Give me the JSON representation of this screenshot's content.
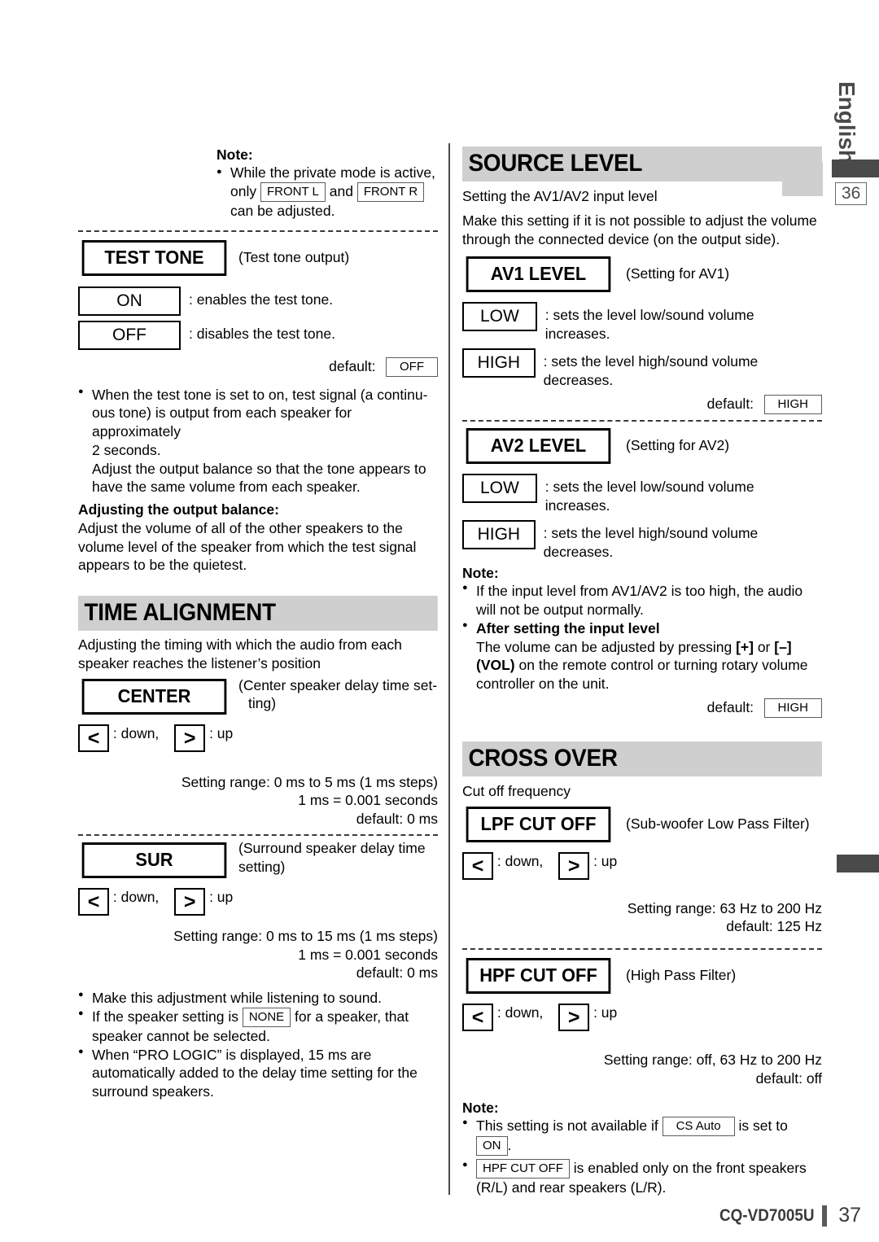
{
  "page": {
    "language_tab": "English",
    "ref_page_number": "36",
    "footer_model": "CQ-VD7005U",
    "footer_page": "37"
  },
  "left_column": {
    "note_top": {
      "label": "Note:",
      "bullets": [
        {
          "parts": [
            {
              "type": "text",
              "value": "While the private mode is active, only "
            },
            {
              "type": "ref",
              "value": "FRONT L"
            },
            {
              "type": "text",
              "value": " and "
            },
            {
              "type": "ref",
              "value": "FRONT R"
            },
            {
              "type": "text",
              "value": " can be adjusted."
            }
          ]
        }
      ]
    },
    "test_tone": {
      "key_label": "TEST TONE",
      "caption": "(Test tone output)",
      "options": [
        {
          "box": "ON",
          "desc": ": enables the test tone."
        },
        {
          "box": "OFF",
          "desc": ": disables the test tone."
        }
      ],
      "default_label": "default:",
      "default_value": "OFF",
      "bullets": [
        "When the test tone is set to on,  test signal (a continu-ous tone) is output from each speaker for approximately 2 seconds.",
        "Adjust the output balance so that the tone appears to have the same volume from each speaker."
      ],
      "bullet_line_1a": "When the test tone is set to on,  test signal (a continu-",
      "bullet_line_1b": "ous tone) is output from each speaker for approximately",
      "bullet_line_1c": "2 seconds.",
      "bullet_line_1d": "Adjust the output balance so that the tone appears to",
      "bullet_line_1e": "have the same volume from each speaker.",
      "balance_heading": "Adjusting the output balance:",
      "balance_body": "Adjust the volume of all of the other speakers to the volume level of the speaker from which the test signal appears to be the quietest."
    },
    "time_alignment": {
      "heading": "TIME ALIGNMENT",
      "intro": "Adjusting the timing with which the audio from each speaker reaches the listener’s position",
      "center": {
        "key_label": "CENTER",
        "caption_line1": "(Center speaker delay time set-",
        "caption_line2": "ting)",
        "down_label": ": down,",
        "up_label": ": up",
        "down_glyph": "<",
        "up_glyph": ">",
        "range": "Setting range: 0 ms to 5 ms (1 ms steps)",
        "conversion": "1 ms = 0.001 seconds",
        "default": "default: 0 ms"
      },
      "sur": {
        "key_label": "SUR",
        "caption_line1": "(Surround speaker delay time",
        "caption_line2": "setting)",
        "down_label": ": down,",
        "up_label": ": up",
        "down_glyph": "<",
        "up_glyph": ">",
        "range": "Setting range: 0 ms to 15 ms (1 ms steps)",
        "conversion": "1 ms = 0.001 seconds",
        "default": "default: 0 ms"
      },
      "notes": [
        {
          "parts": [
            {
              "type": "text",
              "value": "Make this adjustment while listening to sound."
            }
          ]
        },
        {
          "parts": [
            {
              "type": "text",
              "value": "If the speaker setting is "
            },
            {
              "type": "ref",
              "value": "NONE"
            },
            {
              "type": "text",
              "value": " for a speaker, that speaker cannot be selected."
            }
          ]
        },
        {
          "parts": [
            {
              "type": "text",
              "value": "When “PRO LOGIC” is displayed, 15 ms are automatically added to the delay time setting for the surround speakers."
            }
          ]
        }
      ]
    }
  },
  "right_column": {
    "source_level": {
      "heading": "SOURCE LEVEL",
      "subtitle": "Setting the AV1/AV2 input level",
      "intro": "Make this setting if it is not possible to adjust the volume through the connected device (on the output side).",
      "av1": {
        "key_label": "AV1 LEVEL",
        "caption": "(Setting for AV1)",
        "options": [
          {
            "box": "LOW",
            "desc": ": sets the level low/sound volume increases."
          },
          {
            "box": "HIGH",
            "desc": ": sets the level high/sound volume decreases."
          }
        ],
        "default_label": "default:",
        "default_value": "HIGH"
      },
      "av2": {
        "key_label": "AV2 LEVEL",
        "caption": "(Setting for AV2)",
        "options": [
          {
            "box": "LOW",
            "desc": ": sets the level low/sound volume increases."
          },
          {
            "box": "HIGH",
            "desc": ": sets the level high/sound volume decreases."
          }
        ],
        "default_label": "default:",
        "default_value": "HIGH"
      },
      "note_label": "Note:",
      "note_bullet_1": "If the input level from AV1/AV2 is too high, the audio will not be output normally.",
      "note_bullet_2_heading": "After setting the input level",
      "note_bullet_2_pre": "The volume can be adjusted by pressing ",
      "note_bullet_2_plus": "[+]",
      "note_bullet_2_or": " or ",
      "note_bullet_2_minus": "[–]",
      "note_bullet_2_vol": "(VOL)",
      "note_bullet_2_post": " on the remote control or turning rotary volume controller on the unit."
    },
    "cross_over": {
      "heading": "CROSS OVER",
      "subtitle": "Cut off frequency",
      "lpf": {
        "key_label": "LPF CUT OFF",
        "caption": "(Sub-woofer Low Pass Filter)",
        "down_label": ": down,",
        "up_label": ": up",
        "down_glyph": "<",
        "up_glyph": ">",
        "range": "Setting range: 63 Hz to 200 Hz",
        "default": "default: 125 Hz"
      },
      "hpf": {
        "key_label": "HPF CUT OFF",
        "caption": "(High Pass Filter)",
        "down_label": ": down,",
        "up_label": ": up",
        "down_glyph": "<",
        "up_glyph": ">",
        "range": "Setting range: off, 63 Hz to 200 Hz",
        "default": "default: off"
      },
      "note_label": "Note:",
      "note_bullet_1_pre": "This setting is not available if ",
      "note_bullet_1_ref1": "CS Auto",
      "note_bullet_1_mid": " is set to ",
      "note_bullet_1_ref2": "ON",
      "note_bullet_1_post": ".",
      "note_bullet_2_ref": "HPF CUT OFF",
      "note_bullet_2_line1": " is enabled only on the front speakers",
      "note_bullet_2_line2": "(R/L) and rear speakers (L/R)."
    }
  }
}
